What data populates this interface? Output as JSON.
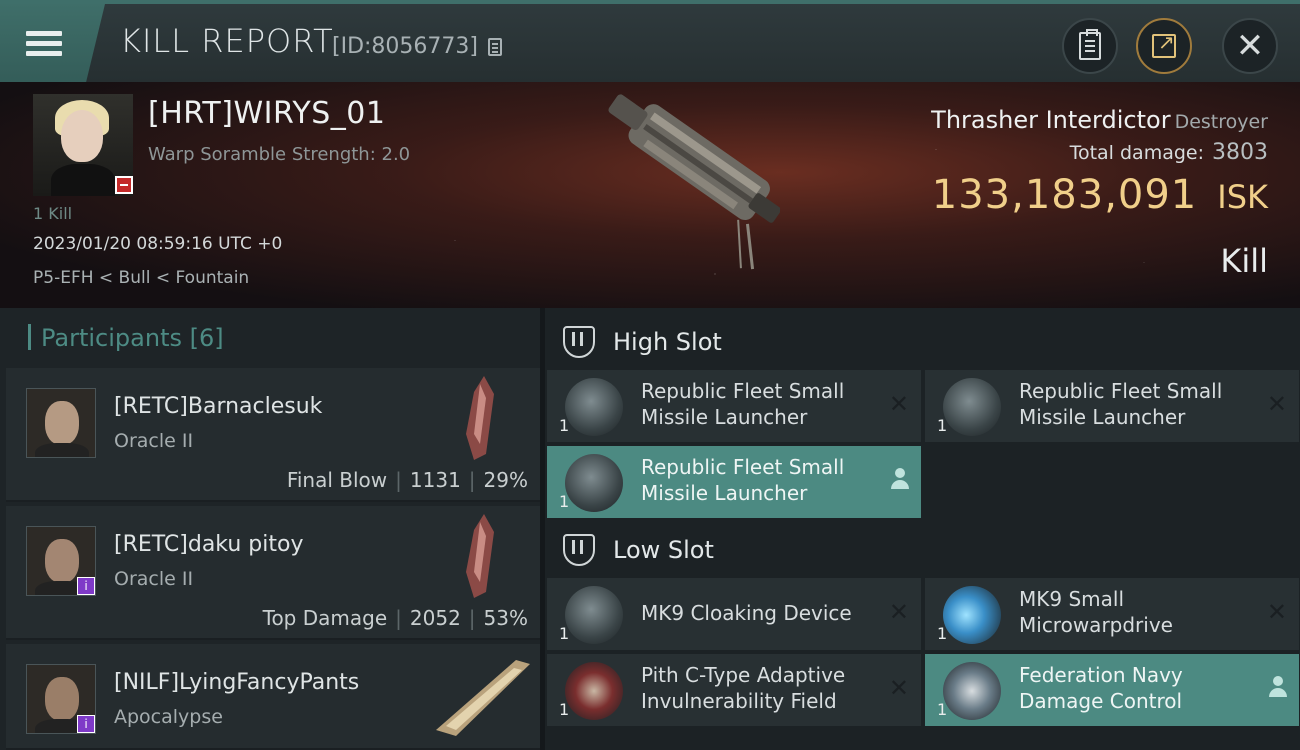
{
  "header": {
    "title": "KILL REPORT",
    "report_id": "[ID:8056773]"
  },
  "victim": {
    "name": "[HRT]WIRYS_01",
    "warp_scramble": "Warp Soramble Strength: 2.0",
    "kill_count": "1 Kill",
    "timestamp": "2023/01/20 08:59:16 UTC +0",
    "location": "P5-EFH < Bull < Fountain"
  },
  "ship": {
    "name": "Thrasher Interdictor",
    "class": "Destroyer",
    "total_damage_label": "Total damage:",
    "total_damage": "3803",
    "isk_value": "133,183,091",
    "isk_unit": "ISK",
    "result": "Kill"
  },
  "participants": {
    "title": "Participants",
    "count": "[6]",
    "rows": [
      {
        "name": "[RETC]Barnaclesuk",
        "ship": "Oracle II",
        "role": "Final Blow",
        "damage": "1131",
        "percent": "29%"
      },
      {
        "name": "[RETC]daku pitoy",
        "ship": "Oracle II",
        "role": "Top Damage",
        "damage": "2052",
        "percent": "53%"
      },
      {
        "name": "[NILF]LyingFancyPants",
        "ship": "Apocalypse",
        "role": "",
        "damage": "",
        "percent": ""
      }
    ]
  },
  "fitting": {
    "high_slot_label": "High Slot",
    "low_slot_label": "Low Slot",
    "high": [
      {
        "name": "Republic Fleet Small Missile Launcher",
        "qty": "1",
        "state": "destroyed"
      },
      {
        "name": "Republic Fleet Small Missile Launcher",
        "qty": "1",
        "state": "destroyed"
      },
      {
        "name": "Republic Fleet Small Missile Launcher",
        "qty": "1",
        "state": "dropped"
      }
    ],
    "low": [
      {
        "name": "MK9 Cloaking Device",
        "qty": "1",
        "state": "destroyed"
      },
      {
        "name": "MK9 Small Microwarpdrive",
        "qty": "1",
        "state": "destroyed"
      },
      {
        "name": "Pith C-Type Adaptive Invulnerability Field",
        "qty": "1",
        "state": "destroyed"
      },
      {
        "name": "Federation Navy Damage Control",
        "qty": "1",
        "state": "dropped"
      }
    ]
  },
  "icons": {
    "menu": "hamburger-icon",
    "copy": "copy-icon",
    "clipboard": "clipboard-icon",
    "share": "share-icon",
    "close": "close-icon",
    "destroyed": "x-icon",
    "dropped": "person-icon"
  },
  "colors": {
    "accent": "#4c8a82",
    "isk": "#f0cf8a",
    "badge_corp": "#c42a2a",
    "badge_alliance": "#7f3ac8"
  }
}
